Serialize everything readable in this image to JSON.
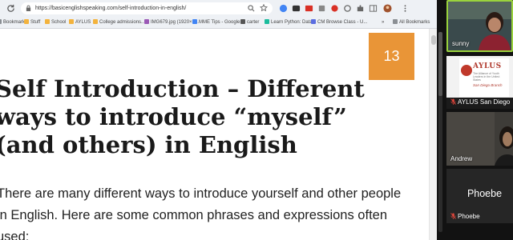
{
  "browser": {
    "url": "https://basicenglishspeaking.com/self-introduction-in-english/",
    "bookmarks": [
      {
        "label": "Bookmarks",
        "color": "#8b8f94"
      },
      {
        "label": "Stuff",
        "color": "#f3b33d"
      },
      {
        "label": "School",
        "color": "#f3b33d"
      },
      {
        "label": "AYLUS",
        "color": "#f3b33d"
      },
      {
        "label": "College admissions...",
        "color": "#f3b33d"
      },
      {
        "label": "IMG679.jpg (1920×1...",
        "color": "#9b59b6"
      },
      {
        "label": "MME Tips - Google...",
        "color": "#4285f4"
      },
      {
        "label": "carter",
        "color": "#555555"
      },
      {
        "label": "Learn Python: Data...",
        "color": "#1abc9c"
      },
      {
        "label": "CM Browse Class - U...",
        "color": "#5b6ee1"
      }
    ],
    "bookmarks_overflow": "»",
    "all_bookmarks": "All Bookmarks"
  },
  "article": {
    "badge": "13",
    "title": "Self Introduction – Different ways to introduce “myself” (and others) in English",
    "intro": "There are many different ways to introduce yourself and other people in English. Here are some common phrases and expressions often used:"
  },
  "participants": {
    "sunny": "sunny",
    "aylus": "AYLUS San Diego",
    "andrew": "Andrew",
    "phoebe": "Phoebe",
    "phoebe_display": "Phoebe"
  },
  "aylus_slide": {
    "name": "AYLUS",
    "subtitle": "The Alliance of Youth Leaders in the United States",
    "branch": "San Diego Branch"
  },
  "colors": {
    "badge": "#e99537",
    "speaker_border": "#9ad33d",
    "muted": "#e0463b"
  }
}
